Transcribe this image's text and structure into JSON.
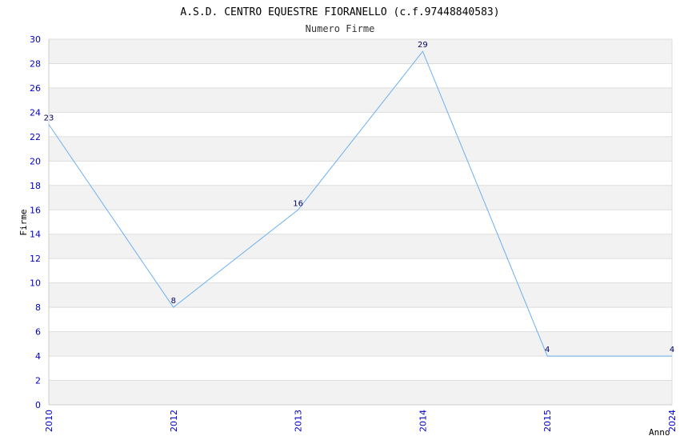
{
  "chart_data": {
    "type": "line",
    "title": "A.S.D. CENTRO EQUESTRE FIORANELLO (c.f.97448840583)",
    "subtitle": "Numero Firme",
    "xlabel": "Anno",
    "ylabel": "Firme",
    "x": [
      2010,
      2012,
      2013,
      2014,
      2015,
      2024
    ],
    "y": [
      23,
      8,
      16,
      29,
      4,
      4
    ],
    "data_labels": [
      "23",
      "8",
      "16",
      "29",
      "4",
      "4"
    ],
    "xticks": [
      "2010",
      "2012",
      "2013",
      "2014",
      "2015",
      "2024"
    ],
    "yticks": [
      "0",
      "2",
      "4",
      "6",
      "8",
      "10",
      "12",
      "14",
      "16",
      "18",
      "20",
      "22",
      "24",
      "26",
      "28",
      "30"
    ],
    "ylim": [
      0,
      30
    ],
    "grid": true,
    "x_scale": "categorical-evenly-spaced",
    "colors": {
      "line": "#6ab0f0",
      "band": "#f2f2f2",
      "tick_text": "#0000cc",
      "data_label": "#000066"
    }
  }
}
